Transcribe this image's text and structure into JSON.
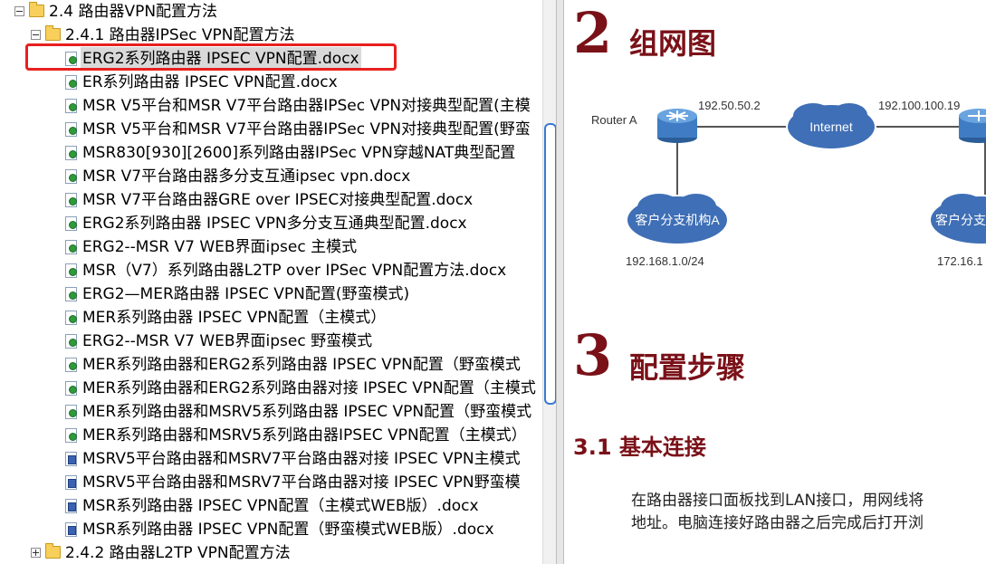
{
  "tree": {
    "items": [
      {
        "label": "2.4 路由器VPN配置方法",
        "type": "folder",
        "expander": "minus"
      },
      {
        "label": "2.4.1 路由器IPSec VPN配置方法",
        "type": "folder",
        "expander": "minus"
      },
      {
        "label": "ERG2系列路由器 IPSEC VPN配置.docx",
        "type": "doc",
        "selected": true
      },
      {
        "label": "ER系列路由器 IPSEC VPN配置.docx",
        "type": "doc"
      },
      {
        "label": "MSR V5平台和MSR V7平台路由器IPSec VPN对接典型配置(主模",
        "type": "doc"
      },
      {
        "label": "MSR V5平台和MSR V7平台路由器IPSec VPN对接典型配置(野蛮",
        "type": "doc"
      },
      {
        "label": "MSR830[930][2600]系列路由器IPSec VPN穿越NAT典型配置",
        "type": "doc"
      },
      {
        "label": "MSR V7平台路由器多分支互通ipsec vpn.docx",
        "type": "doc"
      },
      {
        "label": "MSR V7平台路由器GRE over IPSEC对接典型配置.docx",
        "type": "doc"
      },
      {
        "label": "ERG2系列路由器 IPSEC VPN多分支互通典型配置.docx",
        "type": "doc"
      },
      {
        "label": "ERG2--MSR V7 WEB界面ipsec 主模式",
        "type": "doc"
      },
      {
        "label": "MSR（V7）系列路由器L2TP over IPSec VPN配置方法.docx",
        "type": "doc"
      },
      {
        "label": "ERG2—MER路由器 IPSEC VPN配置(野蛮模式)",
        "type": "doc"
      },
      {
        "label": "MER系列路由器 IPSEC VPN配置（主模式）",
        "type": "doc"
      },
      {
        "label": "ERG2--MSR V7 WEB界面ipsec 野蛮模式",
        "type": "doc"
      },
      {
        "label": "MER系列路由器和ERG2系列路由器 IPSEC VPN配置（野蛮模式",
        "type": "doc"
      },
      {
        "label": "MER系列路由器和ERG2系列路由器对接 IPSEC VPN配置（主模式",
        "type": "doc"
      },
      {
        "label": "MER系列路由器和MSRV5系列路由器 IPSEC VPN配置（野蛮模式",
        "type": "doc"
      },
      {
        "label": "MER系列路由器和MSRV5系列路由器IPSEC VPN配置（主模式）",
        "type": "doc"
      },
      {
        "label": "MSRV5平台路由器和MSRV7平台路由器对接 IPSEC VPN主模式",
        "type": "word"
      },
      {
        "label": "MSRV5平台路由器和MSRV7平台路由器对接 IPSEC VPN野蛮模",
        "type": "word"
      },
      {
        "label": "MSR系列路由器 IPSEC VPN配置（主模式WEB版）.docx",
        "type": "word"
      },
      {
        "label": "MSR系列路由器 IPSEC VPN配置（野蛮模式WEB版）.docx",
        "type": "word"
      },
      {
        "label": "2.4.2 路由器L2TP VPN配置方法",
        "type": "folder",
        "expander": "plus"
      }
    ]
  },
  "document": {
    "section2": {
      "number": "2",
      "title": "组网图"
    },
    "diagram": {
      "router_a_label": "Router A",
      "router_text": "ROUTER",
      "ip_left": "192.50.50.2",
      "ip_right": "192.100.100.19",
      "internet_label": "Internet",
      "branch_a_label": "客户分支机构A",
      "branch_b_label": "客户分支",
      "subnet_a": "192.168.1.0/24",
      "subnet_b": "172.16.1"
    },
    "section3": {
      "number": "3",
      "title": "配置步骤"
    },
    "section31": {
      "title": "3.1 基本连接"
    },
    "para_line1": "在路由器接口面板找到LAN接口，用网线将",
    "para_line2": "地址。电脑连接好路由器之后完成后打开浏"
  },
  "colors": {
    "heading": "#7a1118",
    "highlight_box": "#e8201f",
    "selection_bg": "#d9d9d9",
    "cloud_blue": "#3f6fb6"
  }
}
